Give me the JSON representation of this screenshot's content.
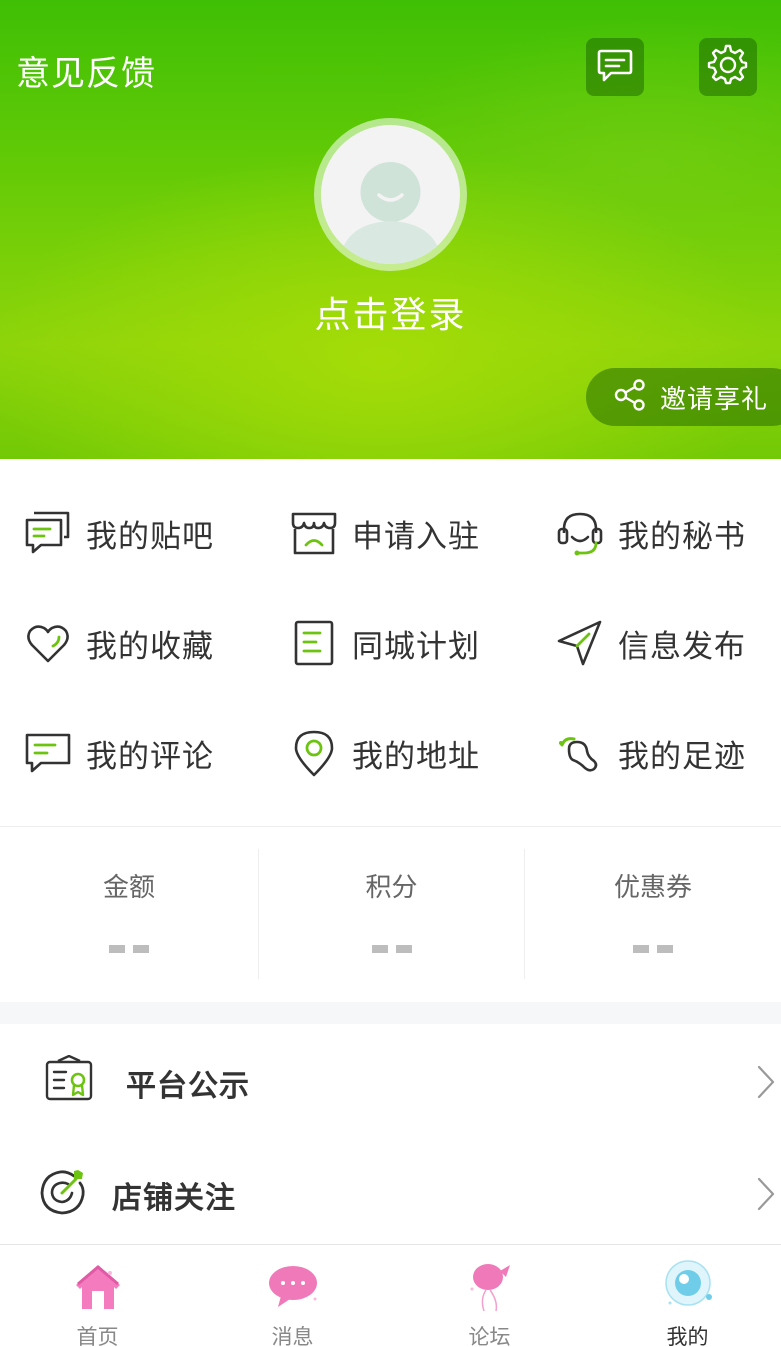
{
  "header": {
    "feedback_label": "意见反馈",
    "login_text": "点击登录",
    "invite_label": "邀请享礼",
    "icons": {
      "message": "message-icon",
      "settings": "gear-icon",
      "share": "share-icon"
    }
  },
  "grid": {
    "items": [
      {
        "label": "我的贴吧",
        "icon": "forum-bubbles-icon"
      },
      {
        "label": "申请入驻",
        "icon": "storefront-icon"
      },
      {
        "label": "我的秘书",
        "icon": "headset-icon"
      },
      {
        "label": "我的收藏",
        "icon": "heart-icon"
      },
      {
        "label": "同城计划",
        "icon": "document-list-icon"
      },
      {
        "label": "信息发布",
        "icon": "send-icon"
      },
      {
        "label": "我的评论",
        "icon": "comment-icon"
      },
      {
        "label": "我的地址",
        "icon": "location-pin-icon"
      },
      {
        "label": "我的足迹",
        "icon": "footprint-icon"
      }
    ]
  },
  "stats": [
    {
      "label": "金额",
      "value": "--"
    },
    {
      "label": "积分",
      "value": "--"
    },
    {
      "label": "优惠券",
      "value": "--"
    }
  ],
  "menu": [
    {
      "label": "平台公示",
      "icon": "certificate-icon"
    },
    {
      "label": "店铺关注",
      "icon": "target-icon"
    }
  ],
  "tabbar": [
    {
      "label": "首页",
      "icon": "home-icon",
      "active": false
    },
    {
      "label": "消息",
      "icon": "chat-bubble-icon",
      "active": false
    },
    {
      "label": "论坛",
      "icon": "balloon-icon",
      "active": false
    },
    {
      "label": "我的",
      "icon": "eye-bubble-icon",
      "active": true
    }
  ],
  "colors": {
    "brand_green": "#5cc506",
    "accent_green": "#8bd30a",
    "tab_pink": "#f272b8",
    "tab_blue": "#5ec6ea",
    "text_dark": "#333333",
    "text_muted": "#888888"
  }
}
